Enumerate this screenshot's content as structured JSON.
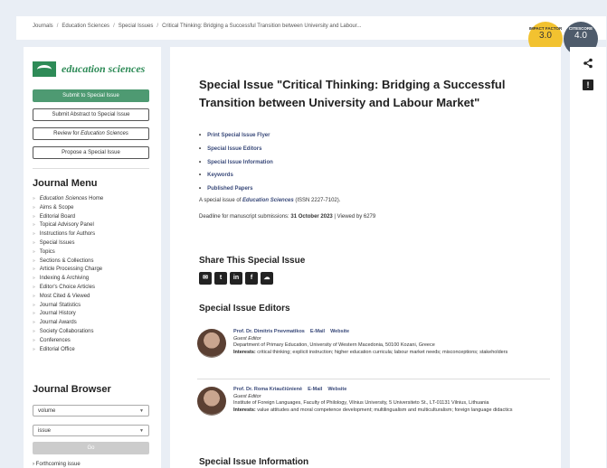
{
  "breadcrumb": [
    "Journals",
    "Education Sciences",
    "Special Issues",
    "Critical Thinking: Bridging a Successful Transition between University and Labour..."
  ],
  "metrics": {
    "impact_factor_label": "IMPACT FACTOR",
    "impact_factor_value": "3.0",
    "citescore_label": "CITESCORE",
    "citescore_value": "4.0"
  },
  "colors": {
    "accent": "#4e9a72",
    "link": "#3a4a7a",
    "impact": "#f2c230",
    "citescore": "#4e5b6b"
  },
  "sidebar": {
    "logo_text": "education sciences",
    "buttons": {
      "submit": "Submit to Special Issue",
      "abstract": "Submit Abstract to Special Issue",
      "review_prefix": "Review for ",
      "review_journal": "Education Sciences",
      "propose": "Propose a Special Issue"
    },
    "journal_menu_title": "Journal Menu",
    "menu_home_journal": "Education Sciences",
    "menu_home_suffix": " Home",
    "menu": [
      "Aims & Scope",
      "Editorial Board",
      "Topical Advisory Panel",
      "Instructions for Authors",
      "Special Issues",
      "Topics",
      "Sections & Collections",
      "Article Processing Charge",
      "Indexing & Archiving",
      "Editor's Choice Articles",
      "Most Cited & Viewed",
      "Journal Statistics",
      "Journal History",
      "Journal Awards",
      "Society Collaborations",
      "Conferences",
      "Editorial Office"
    ],
    "journal_browser_title": "Journal Browser",
    "volume_select": "volume",
    "issue_select": "issue",
    "go_button": "Go",
    "forthcoming": "Forthcoming issue"
  },
  "main": {
    "title": "Special Issue \"Critical Thinking: Bridging a Successful Transition between University and Labour Market\"",
    "links": [
      "Print Special Issue Flyer",
      "Special Issue Editors",
      "Special Issue Information",
      "Keywords",
      "Published Papers"
    ],
    "issue_line_prefix": "A special issue of ",
    "issue_line_journal": "Education Sciences",
    "issue_line_suffix": " (ISSN 2227-7102).",
    "deadline_prefix": "Deadline for manuscript submissions: ",
    "deadline_date": "31 October 2023",
    "views": " | Viewed by 6279",
    "share_title": "Share This Special Issue",
    "share_icons": [
      "email-icon",
      "twitter-icon",
      "linkedin-icon",
      "facebook-icon",
      "wechat-icon"
    ],
    "editors_title": "Special Issue Editors",
    "editors": [
      {
        "name": "Prof. Dr. Dimitris Pnevmatikos",
        "email": "E-Mail",
        "website": "Website",
        "role": "Guest Editor",
        "affiliation": "Department of Primary Education, University of Western Macedonia, 50100 Kozani, Greece",
        "interests_label": "Interests:",
        "interests": " critical thinking; explicit instruction; higher education curricula; labour market needs; misconceptions; stakeholders"
      },
      {
        "name": "Prof. Dr. Roma Kriaučiūnienė",
        "email": "E-Mail",
        "website": "Website",
        "role": "Guest Editor",
        "affiliation": "Institute of Foreign Languages, Faculty of Philology, Vilnius University, 5 Universiteto St., LT-01131 Vilnius, Lithuania",
        "interests_label": "Interests:",
        "interests": " value attitudes and moral competence development; multilingualism and multiculturalism; foreign language didactics"
      }
    ],
    "info_title": "Special Issue Information"
  }
}
